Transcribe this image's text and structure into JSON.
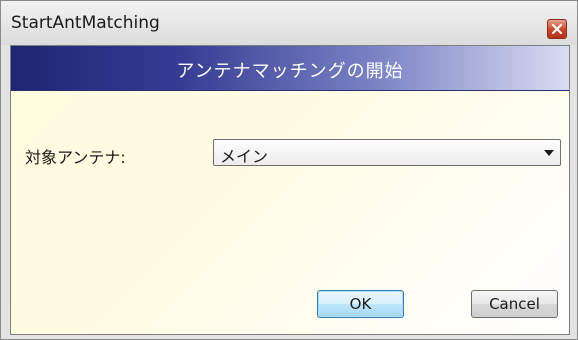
{
  "window": {
    "title": "StartAntMatching"
  },
  "header": {
    "title": "アンテナマッチングの開始"
  },
  "form": {
    "antenna_label": "対象アンテナ:",
    "antenna_select": {
      "selected": "メイン"
    }
  },
  "buttons": {
    "ok_label": "OK",
    "cancel_label": "Cancel"
  },
  "icons": {
    "close": "close-icon",
    "dropdown": "chevron-down-icon"
  },
  "colors": {
    "header_dark": "#1f2573",
    "header_light": "#d9dcf2",
    "close_red": "#c4472c",
    "content_bg": "#fffde0"
  }
}
